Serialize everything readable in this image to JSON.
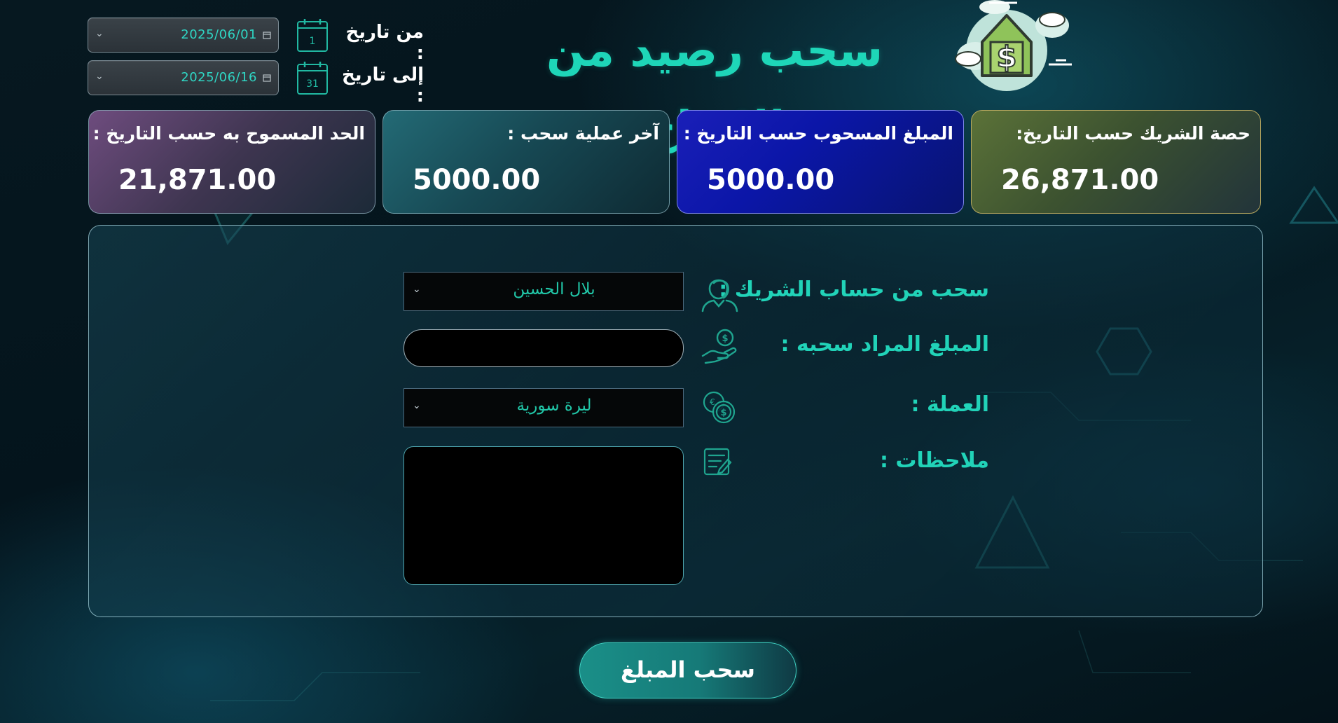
{
  "header": {
    "title": "سحب رصيد من الارباح"
  },
  "date_filter": {
    "from_label": "من تاريخ :",
    "from_value": "2025/06/01",
    "from_calendar_day": "1",
    "to_label": "إلى تاريخ :",
    "to_value": "2025/06/16",
    "to_calendar_day": "31"
  },
  "stats": {
    "partner_share": {
      "label": "حصة الشريك حسب التاريخ:",
      "value": "26,871.00"
    },
    "withdrawn": {
      "label": "المبلغ المسحوب حسب التاريخ :",
      "value": "5000.00"
    },
    "last_withdrawal": {
      "label": "آخر عملية سحب :",
      "value": "5000.00"
    },
    "allowed_limit": {
      "label": "الحد المسموح به حسب التاريخ :",
      "value": "21,871.00"
    }
  },
  "form": {
    "partner_label": "سحب من حساب الشريك :",
    "partner_selected": "بلال الحسين",
    "amount_label": "المبلغ المراد سحبه :",
    "amount_value": "",
    "currency_label": "العملة :",
    "currency_selected": "ليرة سورية",
    "notes_label": "ملاحظات :",
    "notes_value": ""
  },
  "actions": {
    "submit_label": "سحب المبلغ"
  },
  "icons": {
    "emblem": "house-dollar-icon",
    "partner": "partners-icon",
    "amount": "hand-coin-icon",
    "currency": "currency-coins-icon",
    "notes": "notes-icon",
    "calendar": "calendar-icon",
    "dropdown": "chevron-down-icon"
  },
  "colors": {
    "accent": "#21d3b8",
    "share_card": "#5b7238",
    "withdrawn_card": "#0b16a8",
    "last_card": "#174954",
    "allowed_card": "#6e4c7e"
  }
}
